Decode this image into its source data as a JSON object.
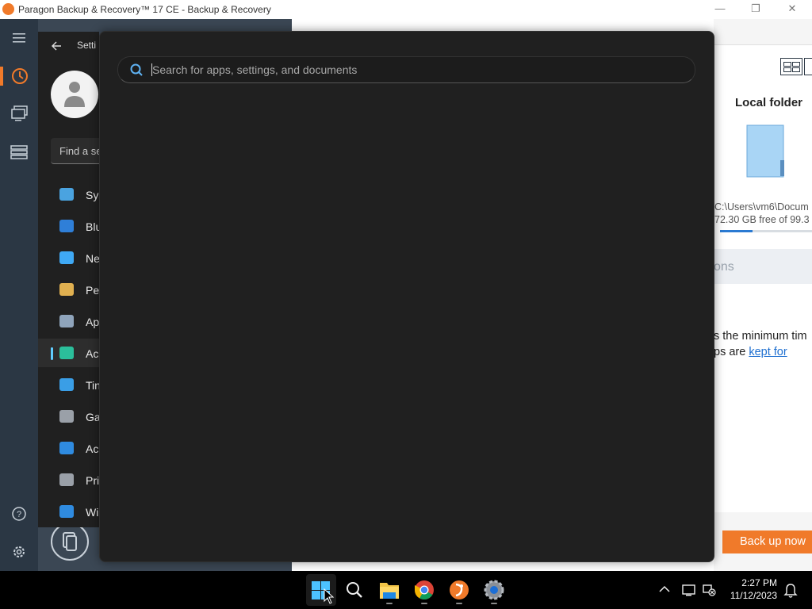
{
  "window": {
    "title": "Paragon Backup & Recovery™ 17 CE - Backup & Recovery",
    "controls": [
      "minimize",
      "maximize",
      "close"
    ],
    "accent": "#f07a2a"
  },
  "paragon_sidebar": {
    "items": [
      {
        "name": "menu-icon"
      },
      {
        "name": "backup-icon",
        "active": true
      },
      {
        "name": "devices-icon"
      },
      {
        "name": "storage-icon"
      },
      {
        "name": "help-icon"
      },
      {
        "name": "settings-gear-icon"
      }
    ]
  },
  "right_panel": {
    "destination_title": "Local folder",
    "path": "C:\\Users\\vm6\\Docum",
    "free_space": "72.30 GB free of 99.3",
    "section_partial": "ons",
    "retention_text_line1": "s the minimum tim",
    "retention_text_line2_prefix": "ps are ",
    "retention_link": "kept for",
    "backup_button": "Back up now",
    "backup_button_color": "#f07a2a",
    "usage_fraction": 0.35
  },
  "settings_window": {
    "title_partial": "Setti",
    "search_placeholder_partial": "Find a se",
    "nav_items": [
      {
        "label": "Sys",
        "icon": "system-icon"
      },
      {
        "label": "Blu",
        "icon": "bluetooth-icon"
      },
      {
        "label": "Ne",
        "icon": "network-icon"
      },
      {
        "label": "Per",
        "icon": "personalization-icon"
      },
      {
        "label": "Ap",
        "icon": "apps-icon"
      },
      {
        "label": "Ac",
        "icon": "accounts-icon",
        "selected": true
      },
      {
        "label": "Tin",
        "icon": "time-language-icon"
      },
      {
        "label": "Ga",
        "icon": "gaming-icon"
      },
      {
        "label": "Ac",
        "icon": "accessibility-icon"
      },
      {
        "label": "Pri",
        "icon": "privacy-icon"
      },
      {
        "label": "Wi",
        "icon": "windows-update-icon"
      }
    ]
  },
  "search_flyout": {
    "placeholder": "Search for apps, settings, and documents"
  },
  "taskbar": {
    "apps": [
      "start-icon",
      "search-icon",
      "file-explorer-icon",
      "chrome-icon",
      "paragon-icon",
      "settings-icon"
    ],
    "time": "2:27 PM",
    "date": "11/12/2023"
  }
}
